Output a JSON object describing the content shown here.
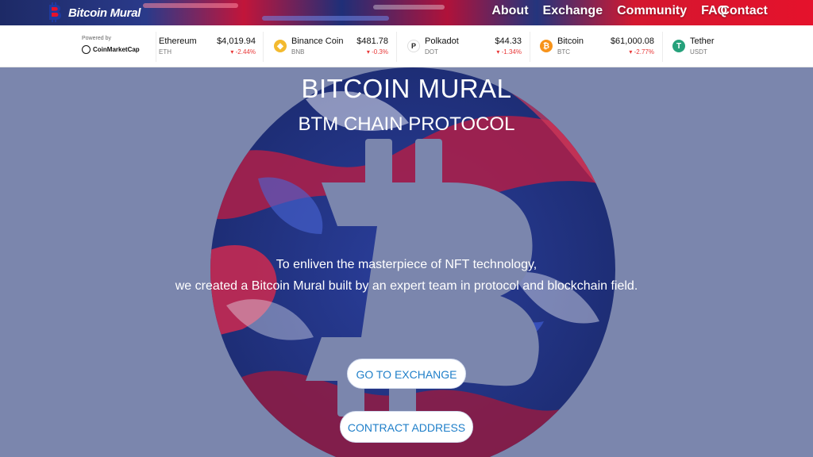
{
  "brand": {
    "name": "Bitcoin Mural"
  },
  "nav": {
    "items": [
      {
        "label": "About"
      },
      {
        "label": "Exchange"
      },
      {
        "label": "Community"
      },
      {
        "label": "FAQ"
      },
      {
        "label": "Contact"
      }
    ]
  },
  "ticker": {
    "powered_label": "Powered by",
    "provider": "CoinMarketCap",
    "coins": [
      {
        "name": "Ethereum",
        "symbol": "ETH",
        "price": "$4,019.94",
        "change": "▾ -2.44%",
        "icon": "ethereum-icon"
      },
      {
        "name": "Binance Coin",
        "symbol": "BNB",
        "price": "$481.78",
        "change": "▾ -0.3%",
        "icon": "binance-coin-icon",
        "color": "#f3ba2f"
      },
      {
        "name": "Polkadot",
        "symbol": "DOT",
        "price": "$44.33",
        "change": "▾ -1.34%",
        "icon": "polkadot-icon"
      },
      {
        "name": "Bitcoin",
        "symbol": "BTC",
        "price": "$61,000.08",
        "change": "▾ -2.77%",
        "icon": "bitcoin-icon",
        "color": "#f7931a"
      },
      {
        "name": "Tether",
        "symbol": "USDT",
        "icon": "tether-icon",
        "color": "#26a17b"
      }
    ],
    "negative_color": "#e83737"
  },
  "hero": {
    "title": "BITCOIN MURAL",
    "subtitle": "BTM CHAIN PROTOCOL",
    "desc_line1": "To enliven the masterpiece of NFT technology,",
    "desc_line2": "we created a Bitcoin Mural built by an expert team in protocol and blockchain field.",
    "btn_exchange": "GO TO EXCHANGE",
    "btn_contract": "CONTRACT ADDRESS",
    "background_color": "#7b86ad",
    "accent_blue": "#1f7fc9"
  }
}
